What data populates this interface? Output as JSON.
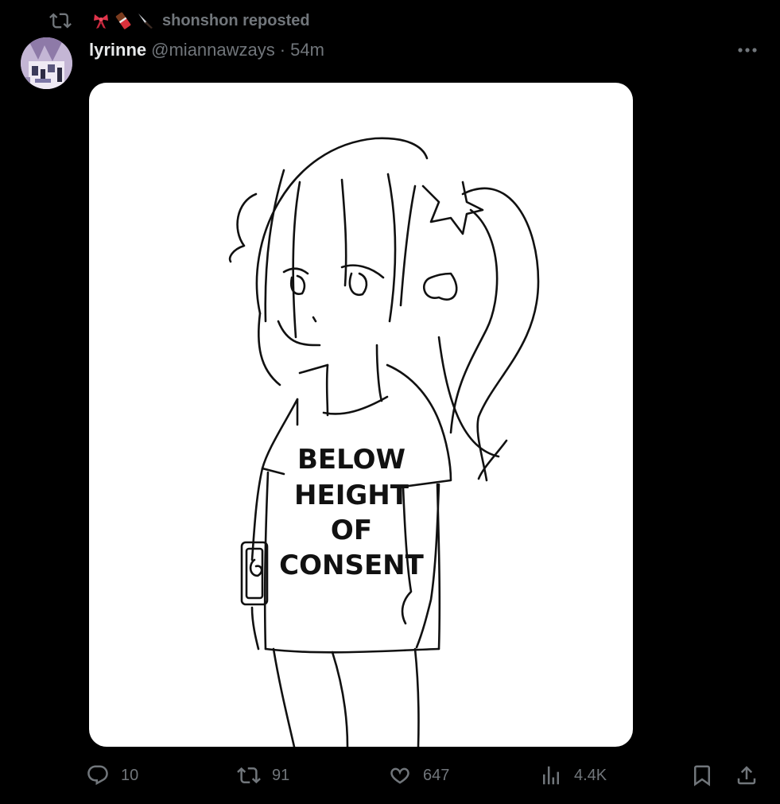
{
  "repost": {
    "icon": "repost-icon",
    "by_label": "shonshon reposted",
    "emojis": [
      "ribbon-emoji",
      "chocolate-emoji",
      "knife-emoji"
    ]
  },
  "post": {
    "display_name": "lyrinne",
    "handle": "@miannawzays",
    "separator": "·",
    "time": "54m",
    "more_icon": "more-horizontal-icon",
    "media": {
      "kind": "line-drawing",
      "shirt_text": [
        "BELOW",
        "HEIGHT",
        "OF",
        "CONSENT"
      ]
    }
  },
  "actions": {
    "reply": {
      "icon": "reply-icon",
      "count": "10"
    },
    "repost": {
      "icon": "repost-icon",
      "count": "91"
    },
    "like": {
      "icon": "heart-icon",
      "count": "647"
    },
    "views": {
      "icon": "views-icon",
      "count": "4.4K"
    },
    "bookmark": {
      "icon": "bookmark-icon"
    },
    "share": {
      "icon": "share-icon"
    }
  },
  "colors": {
    "background": "#000000",
    "primary_text": "#e7e9ea",
    "secondary_text": "#71767b"
  }
}
